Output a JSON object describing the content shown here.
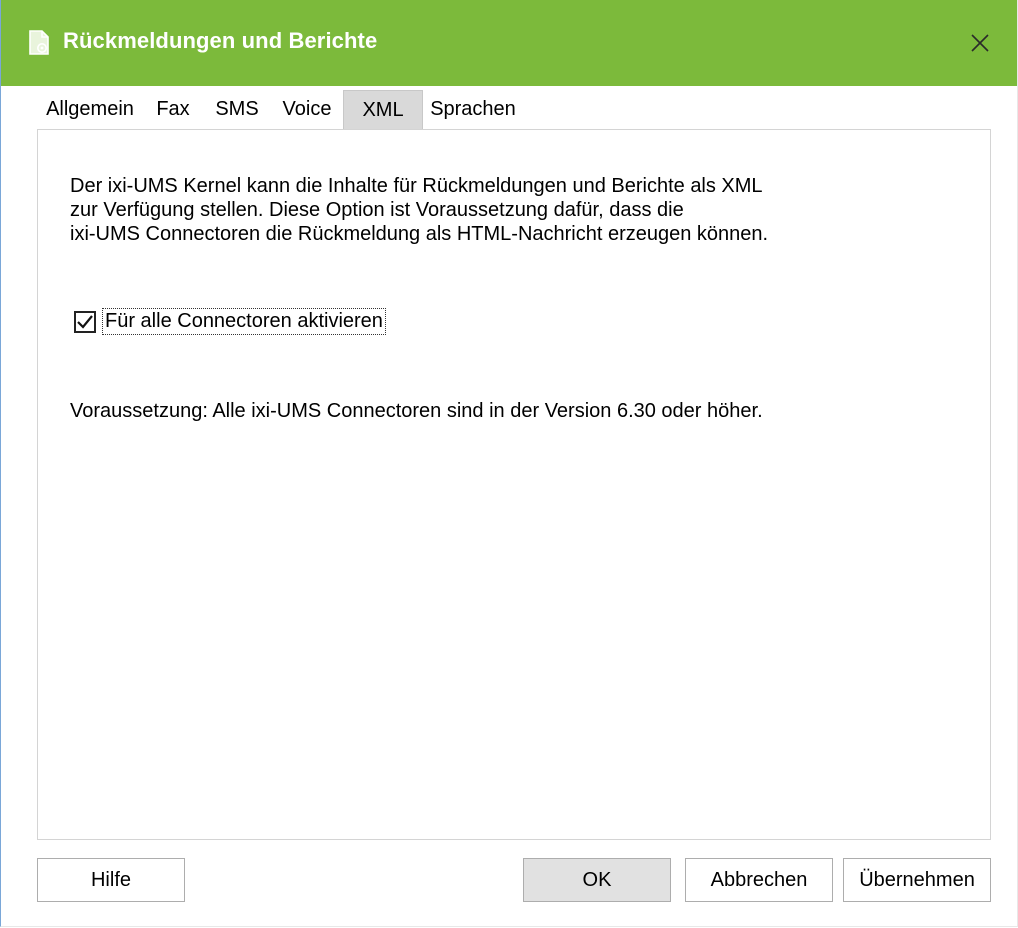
{
  "window": {
    "title": "Rückmeldungen und Berichte",
    "accent_color": "#7cba3b",
    "icon": "document-settings-icon"
  },
  "tabs": [
    {
      "label": "Allgemein",
      "active": false
    },
    {
      "label": "Fax",
      "active": false
    },
    {
      "label": "SMS",
      "active": false
    },
    {
      "label": "Voice",
      "active": false
    },
    {
      "label": "XML",
      "active": true
    },
    {
      "label": "Sprachen",
      "active": false
    }
  ],
  "panel": {
    "description_lines": [
      "Der ixi-UMS Kernel kann die Inhalte für Rückmeldungen und Berichte als XML",
      "zur Verfügung stellen. Diese Option ist Voraussetzung dafür, dass die",
      "ixi-UMS Connectoren die Rückmeldung als HTML-Nachricht erzeugen können."
    ],
    "checkbox": {
      "label": "Für alle Connectoren aktivieren",
      "checked": true
    },
    "prerequisite": "Voraussetzung: Alle ixi-UMS Connectoren sind in der Version 6.30 oder höher."
  },
  "buttons": {
    "help": "Hilfe",
    "ok": "OK",
    "cancel": "Abbrechen",
    "apply": "Übernehmen"
  }
}
